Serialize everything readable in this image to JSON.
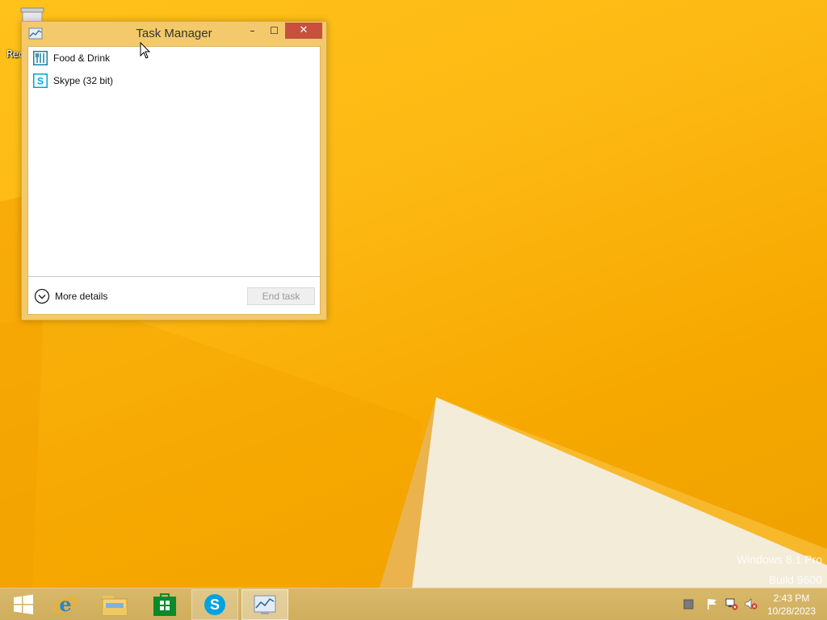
{
  "desktop": {
    "recycle_bin_label": "Rec",
    "watermark": {
      "line1": "Windows 8.1 Pro",
      "line2": "Build 9600"
    }
  },
  "task_manager": {
    "title": "Task Manager",
    "controls": {
      "minimize": "–",
      "maximize": "☐",
      "close": "✕"
    },
    "apps": [
      {
        "label": "Food & Drink",
        "icon": "food-drink-icon"
      },
      {
        "label": "Skype (32 bit)",
        "icon": "skype-icon"
      }
    ],
    "more_details_label": "More details",
    "end_task_label": "End task"
  },
  "taskbar": {
    "items": [
      {
        "name": "start-button",
        "icon": "windows-logo-icon"
      },
      {
        "name": "internet-explorer",
        "icon": "internet-explorer-icon"
      },
      {
        "name": "file-explorer",
        "icon": "folder-icon"
      },
      {
        "name": "store",
        "icon": "store-icon"
      },
      {
        "name": "skype",
        "icon": "skype-icon"
      },
      {
        "name": "task-manager",
        "icon": "task-manager-icon"
      }
    ],
    "tray": [
      "keyboard-icon",
      "flag-icon",
      "network-icon",
      "speaker-muted-icon"
    ],
    "clock": {
      "time": "2:43 PM",
      "date": "10/28/2023"
    }
  },
  "colors": {
    "wallpaper": "#fdb913",
    "window_frame": "#f3c96b",
    "close_button": "#c7503f",
    "taskbar": "#d4b363"
  }
}
